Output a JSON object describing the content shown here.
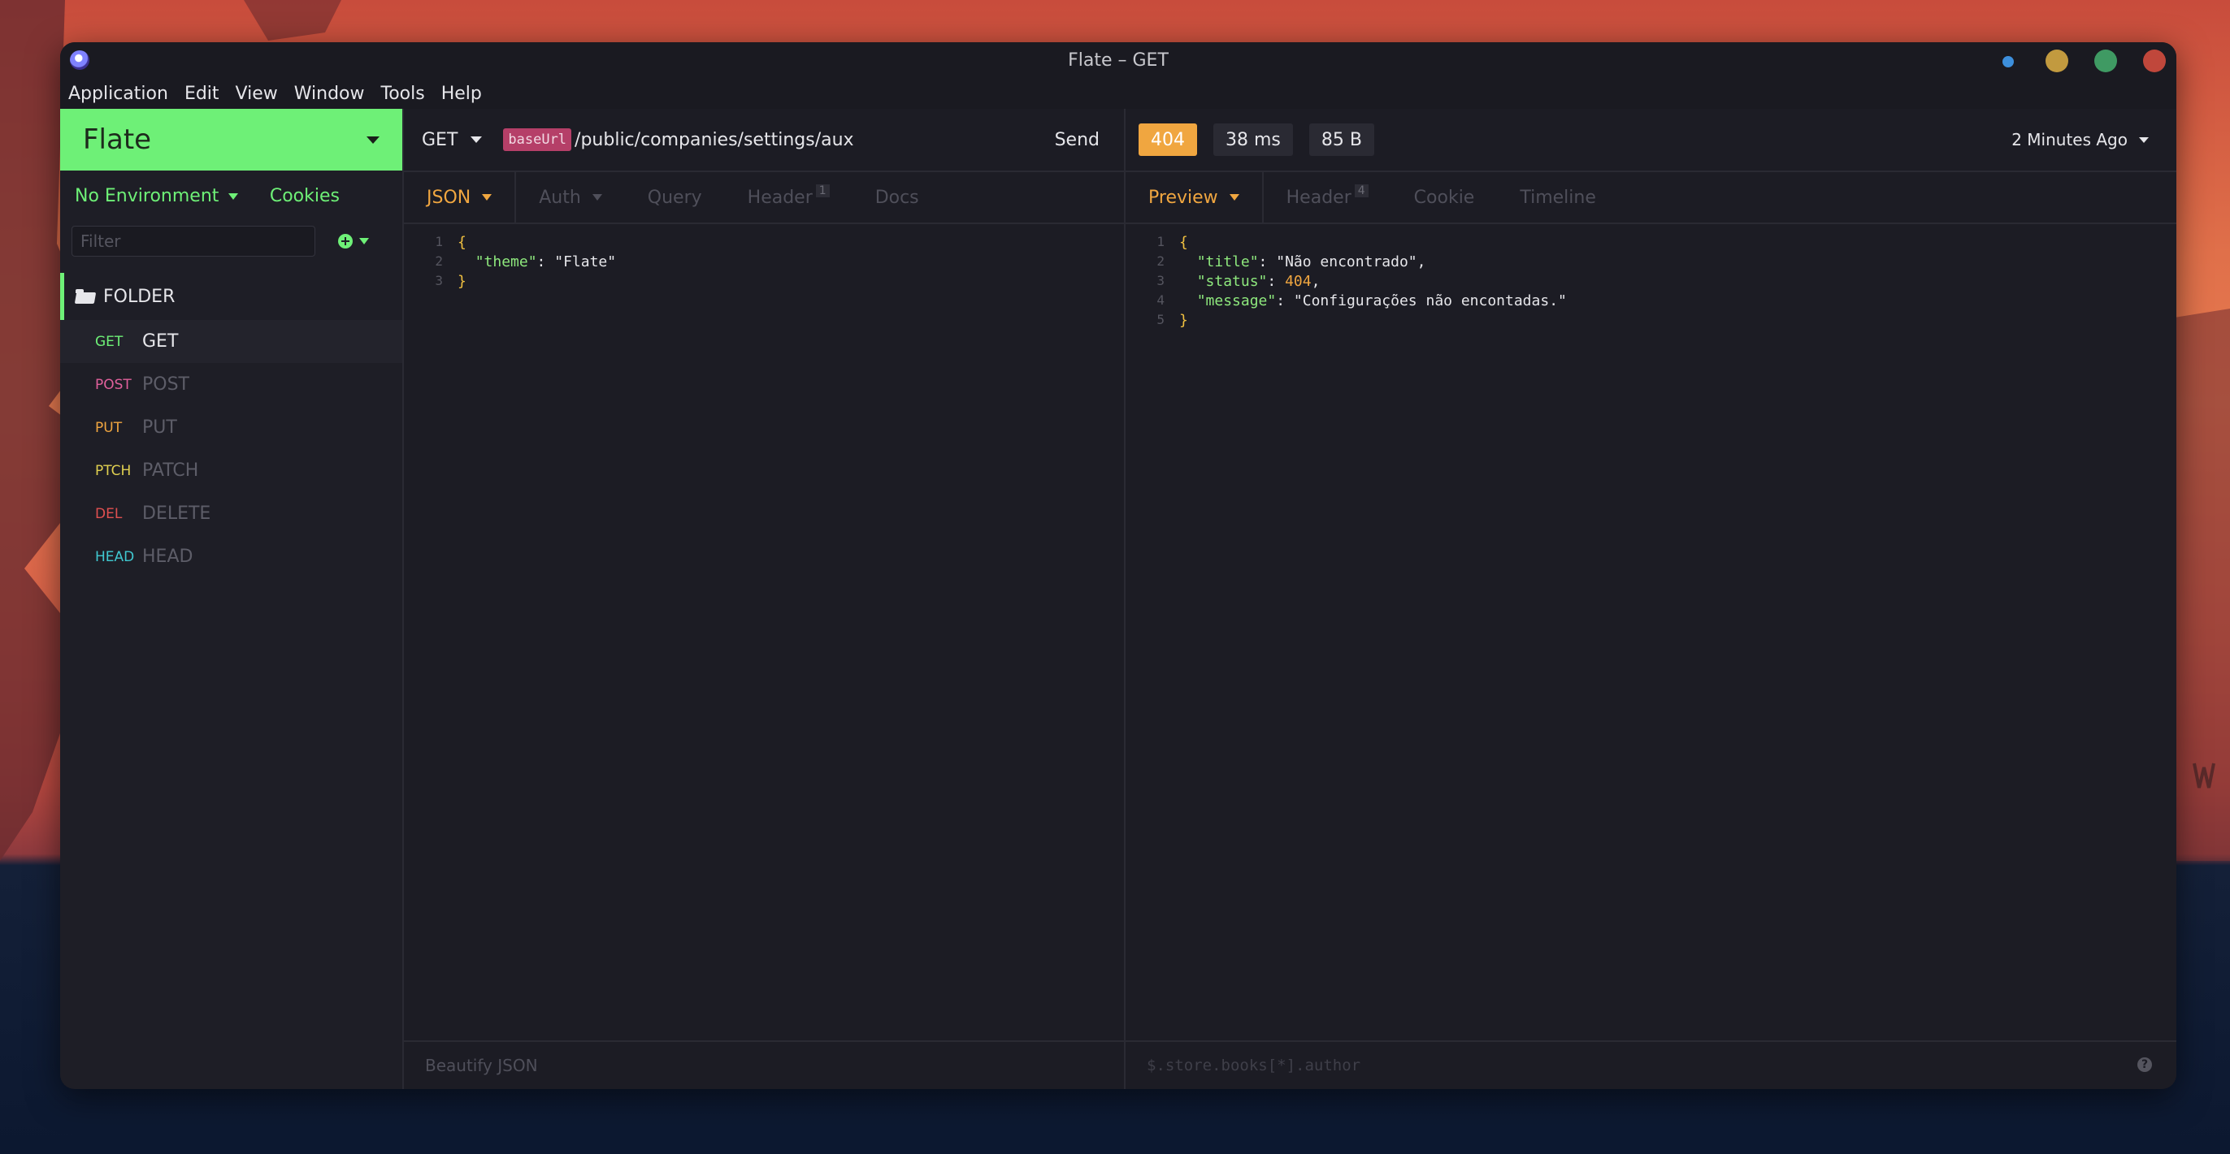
{
  "window": {
    "title": "Flate – GET"
  },
  "menu": [
    "Application",
    "Edit",
    "View",
    "Window",
    "Tools",
    "Help"
  ],
  "sidebar": {
    "workspace": "Flate",
    "environment": "No Environment",
    "cookies": "Cookies",
    "filter_placeholder": "Filter",
    "folder": "FOLDER",
    "requests": [
      {
        "method": "GET",
        "name": "GET",
        "color": "#6ef077",
        "active": true
      },
      {
        "method": "POST",
        "name": "POST",
        "color": "#e0609b",
        "active": false
      },
      {
        "method": "PUT",
        "name": "PUT",
        "color": "#f0a640",
        "active": false
      },
      {
        "method": "PTCH",
        "name": "PATCH",
        "color": "#e0d050",
        "active": false
      },
      {
        "method": "DEL",
        "name": "DELETE",
        "color": "#e05050",
        "active": false
      },
      {
        "method": "HEAD",
        "name": "HEAD",
        "color": "#40c8d0",
        "active": false
      }
    ]
  },
  "request": {
    "method": "GET",
    "base_url_tag": "baseUrl",
    "url_path": "/public/companies/settings/aux",
    "send": "Send",
    "tabs": [
      {
        "label": "JSON",
        "badge": null
      },
      {
        "label": "Auth",
        "badge": null
      },
      {
        "label": "Query",
        "badge": null
      },
      {
        "label": "Header",
        "badge": "1"
      },
      {
        "label": "Docs",
        "badge": null
      }
    ],
    "body_lines": [
      "1",
      "2",
      "3"
    ],
    "body": {
      "open": "{",
      "key": "\"theme\"",
      "value": "\"Flate\"",
      "close": "}"
    },
    "footer": "Beautify JSON"
  },
  "response": {
    "status": "404",
    "time": "38 ms",
    "size": "85 B",
    "history": "2 Minutes Ago",
    "tabs": [
      {
        "label": "Preview",
        "badge": null
      },
      {
        "label": "Header",
        "badge": "4"
      },
      {
        "label": "Cookie",
        "badge": null
      },
      {
        "label": "Timeline",
        "badge": null
      }
    ],
    "body_lines": [
      "1",
      "2",
      "3",
      "4",
      "5"
    ],
    "body": {
      "open": "{",
      "title_key": "\"title\"",
      "title_value": "\"Não encontrado\"",
      "status_key": "\"status\"",
      "status_value": "404",
      "message_key": "\"message\"",
      "message_value": "\"Configurações não encontadas.\"",
      "close": "}"
    },
    "filter_placeholder": "$.store.books[*].author",
    "help_icon": "?"
  },
  "colors": {
    "accent": "#6ef077",
    "warning": "#f0a640",
    "tag": "#b53f68"
  }
}
